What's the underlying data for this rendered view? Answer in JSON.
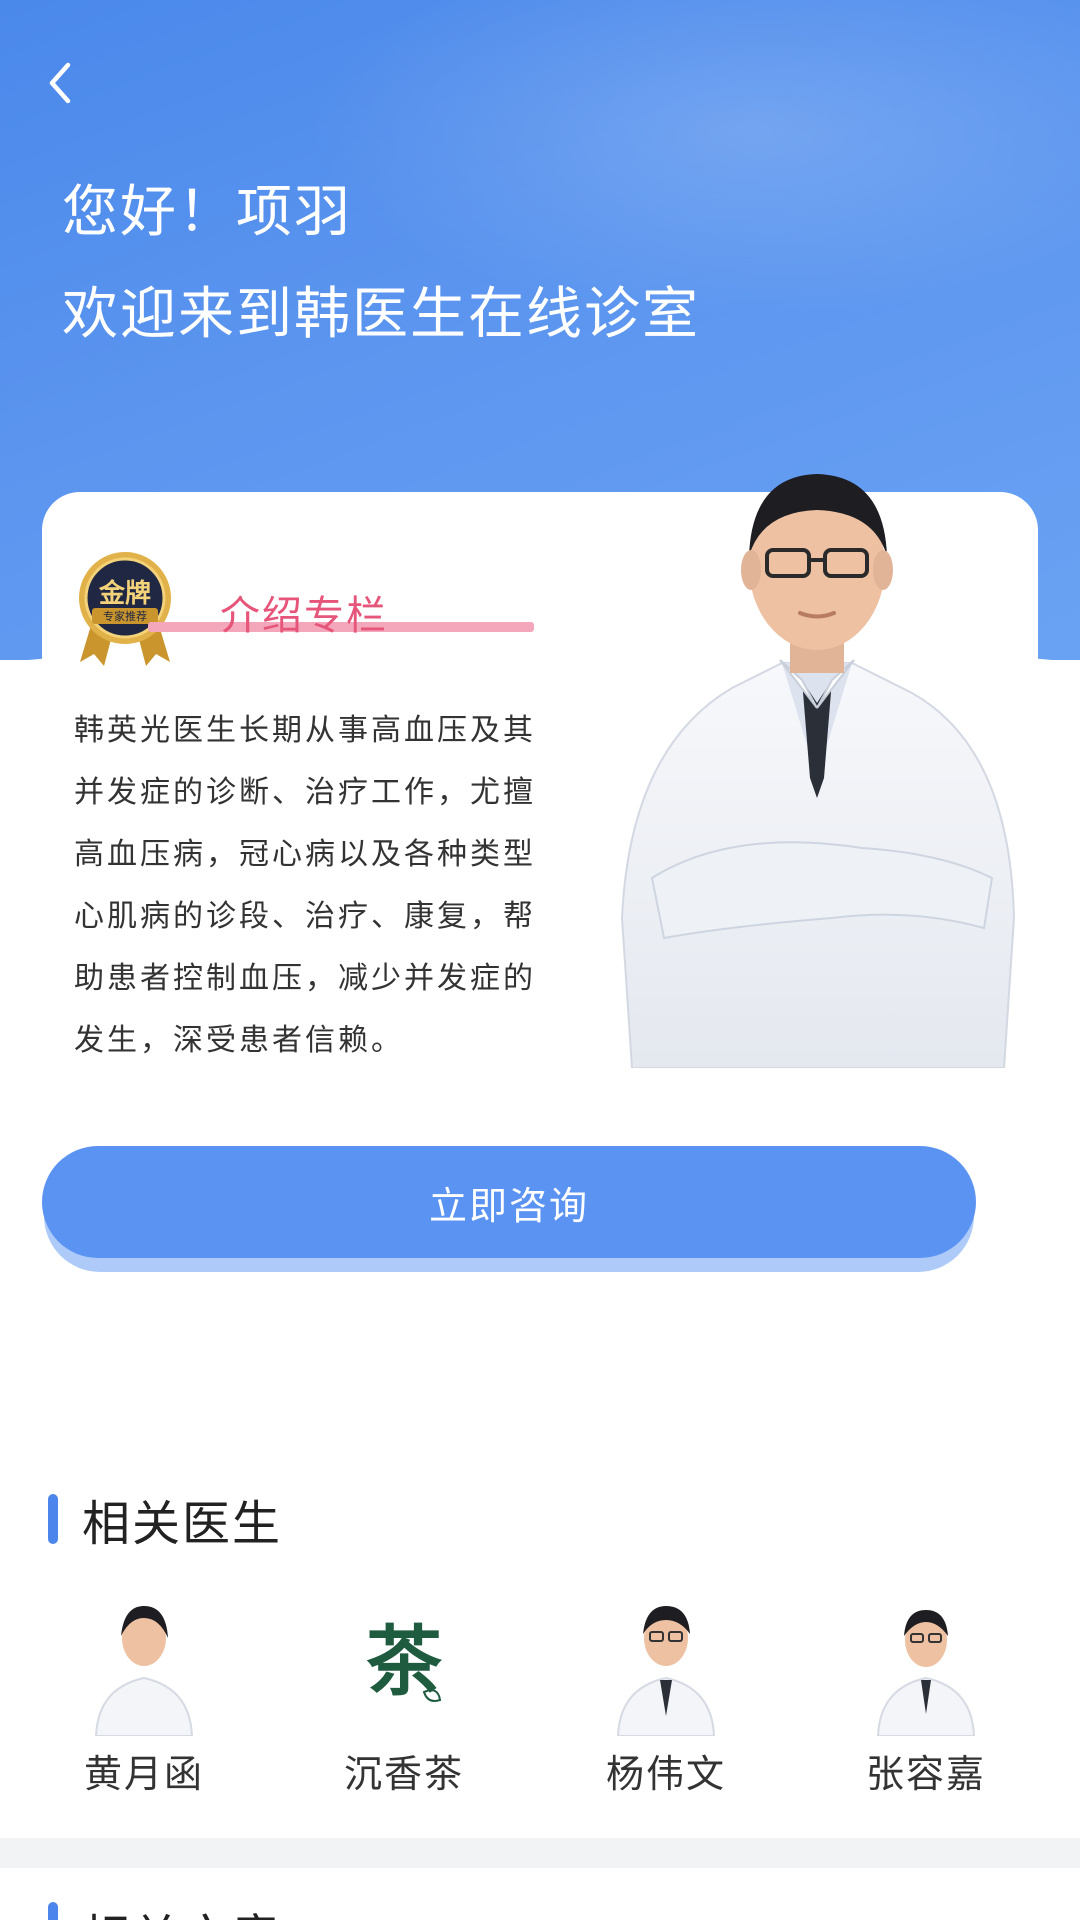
{
  "header": {
    "back_icon": "chevron-left-icon",
    "greeting": "您好！项羽",
    "welcome": "欢迎来到韩医生在线诊室"
  },
  "intro": {
    "badge_top": "金牌",
    "badge_bottom": "专家推荐",
    "section_title": "介绍专栏",
    "bio": "韩英光医生长期从事高血压及其并发症的诊断、治疗工作，尤擅高血压病，冠心病以及各种类型心肌病的诊段、治疗、康复，帮助患者控制血压，减少并发症的发生，深受患者信赖。"
  },
  "consult_button": {
    "label": "立即咨询"
  },
  "related_doctors": {
    "title": "相关医生",
    "items": [
      {
        "name": "黄月函"
      },
      {
        "name": "沉香茶",
        "logo_text": "茶"
      },
      {
        "name": "杨伟文"
      },
      {
        "name": "张容嘉"
      }
    ]
  },
  "related_articles": {
    "title": "相关文章"
  },
  "colors": {
    "primary": "#5b93f3",
    "header_bg": "#4a88ea",
    "tag_pink": "#e6557a",
    "tag_underline": "#f4a7bb",
    "badge_gold": "#c9952c"
  }
}
